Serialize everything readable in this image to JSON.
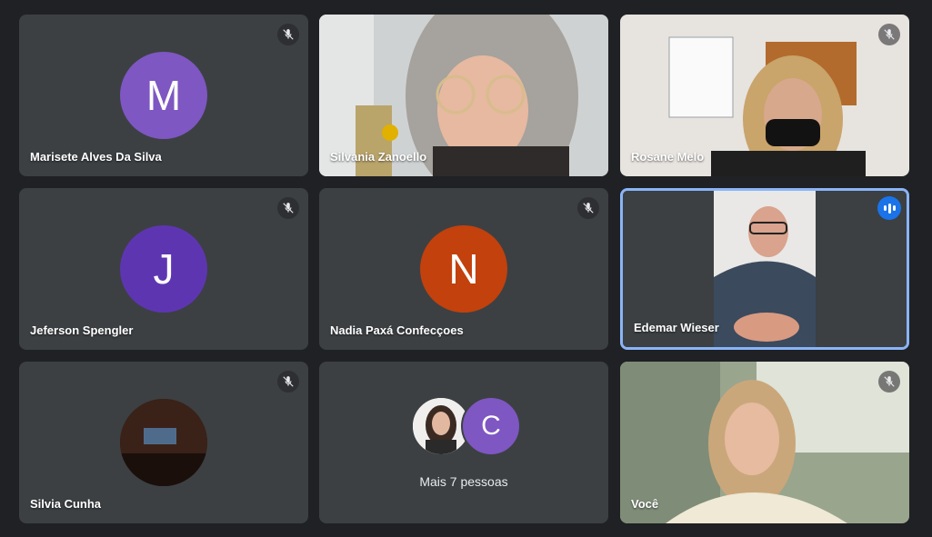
{
  "participants": [
    {
      "name": "Marisete Alves Da Silva",
      "initial": "M",
      "avatar_color": "#7e57c2",
      "muted": true
    },
    {
      "name": "Silvania Zanoello",
      "video": true
    },
    {
      "name": "Rosane Melo",
      "video": true,
      "muted": true
    },
    {
      "name": "Jeferson Spengler",
      "initial": "J",
      "avatar_color": "#5e35b1",
      "muted": true
    },
    {
      "name": "Nadia Paxá Confecçoes",
      "initial": "N",
      "avatar_color": "#c2410c",
      "muted": true
    },
    {
      "name": "Edemar Wieser",
      "video": true,
      "speaking": true
    },
    {
      "name": "Silvia Cunha",
      "avatar_photo": true,
      "muted": true
    },
    {
      "more_label": "Mais 7 pessoas",
      "extra_initial": "C",
      "extra_color": "#7e57c2"
    },
    {
      "name": "Você",
      "video": true,
      "muted": true
    }
  ],
  "colors": {
    "background": "#202124",
    "tile": "#3c4043",
    "speaking_border": "#8ab4f8",
    "speaking_badge": "#1a73e8"
  }
}
